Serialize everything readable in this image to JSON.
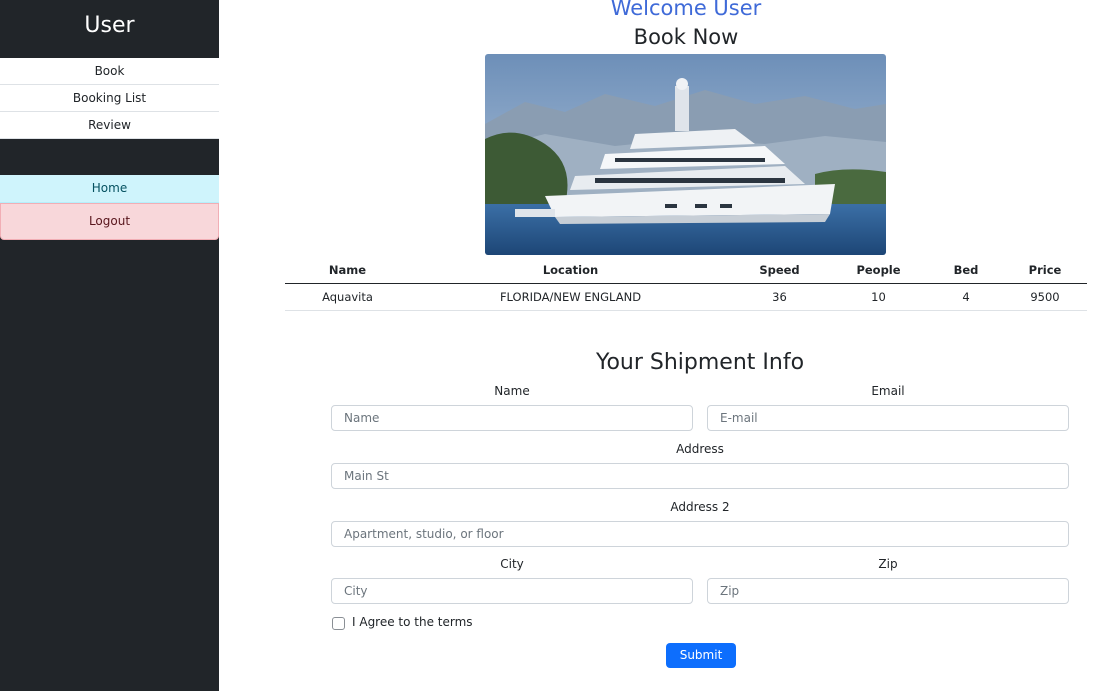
{
  "sidebar": {
    "brand": "User",
    "items": [
      {
        "label": "Book"
      },
      {
        "label": "Booking List"
      },
      {
        "label": "Review"
      }
    ],
    "home_label": "Home",
    "logout_label": "Logout"
  },
  "header": {
    "welcome": "Welcome User",
    "book_now": "Book Now"
  },
  "table": {
    "columns": [
      "Name",
      "Location",
      "Speed",
      "People",
      "Bed",
      "Price"
    ],
    "rows": [
      [
        "Aquavita",
        "FLORIDA/NEW ENGLAND",
        "36",
        "10",
        "4",
        "9500"
      ]
    ]
  },
  "form": {
    "title": "Your Shipment Info",
    "name_label": "Name",
    "name_placeholder": "Name",
    "email_label": "Email",
    "email_placeholder": "E-mail",
    "address_label": "Address",
    "address_placeholder": "Main St",
    "address2_label": "Address 2",
    "address2_placeholder": "Apartment, studio, or floor",
    "city_label": "City",
    "city_placeholder": "City",
    "zip_label": "Zip",
    "zip_placeholder": "Zip",
    "terms_label": "I Agree to the terms",
    "submit_label": "Submit"
  },
  "colors": {
    "sidebar_bg": "#212529",
    "welcome": "#3f6ad8",
    "home_bg": "#cff4fc",
    "logout_bg": "#f8d7da",
    "submit_bg": "#0d6efd"
  }
}
